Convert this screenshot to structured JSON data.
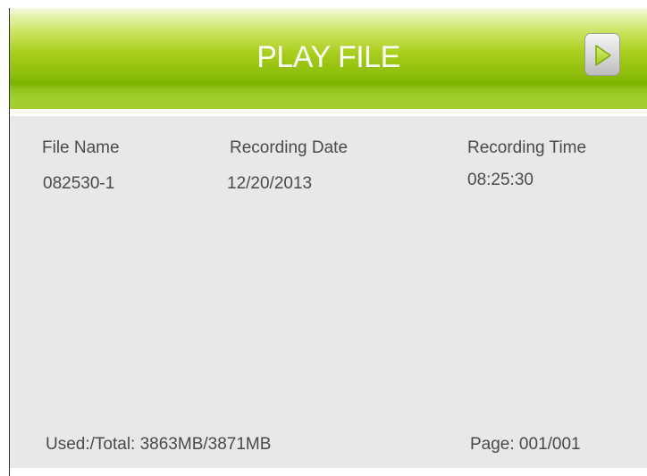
{
  "header": {
    "title": "PLAY FILE",
    "play_icon": "play-triangle-icon",
    "color_top": "#f7fbe6",
    "color_mid": "#8cbd0a",
    "color_bottom": "#a3d030"
  },
  "table": {
    "columns": [
      "File Name",
      "Recording Date",
      "Recording Time"
    ],
    "rows": [
      {
        "file_name": "082530-1",
        "date": "12/20/2013",
        "time": "08:25:30"
      }
    ]
  },
  "footer": {
    "storage": "Used:/Total: 3863MB/3871MB",
    "page": "Page: 001/001"
  },
  "colors": {
    "panel_background": "#e8e8e8",
    "text": "#4a4a4a"
  }
}
